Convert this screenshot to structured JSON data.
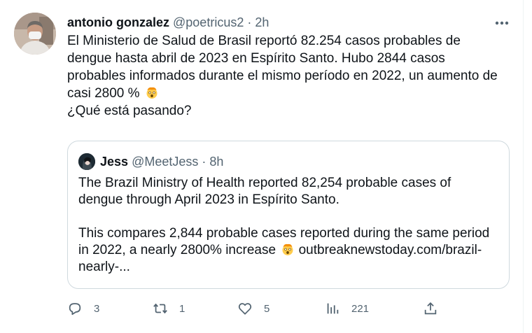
{
  "tweet": {
    "display_name": "antonio gonzalez",
    "handle": "@poetricus2",
    "separator": "·",
    "time": "2h",
    "avatar": "user-avatar-photo",
    "more_icon": "more-horizontal-icon",
    "text_lines": [
      "El Ministerio de Salud de Brasil reportó 82.254 casos probables de",
      "dengue hasta abril de 2023 en Espírito Santo. Hubo 2844 casos",
      "probables informados durante el mismo período en 2022, un aumento de",
      "casi 2800 %",
      "¿Qué está pasando?"
    ],
    "emoji": "exploding-head-emoji"
  },
  "quote": {
    "display_name": "Jess",
    "handle": "@MeetJess",
    "separator": "·",
    "time": "8h",
    "paragraph1": [
      "The Brazil Ministry of Health reported 82,254 probable cases of",
      "dengue through April 2023 in Espírito Santo."
    ],
    "paragraph2": [
      "This compares 2,844 probable cases reported during the same period",
      "in 2022, a nearly 2800% increase",
      "outbreaknewstoday.com/brazil-",
      "nearly-..."
    ]
  },
  "actions": {
    "replies": "3",
    "retweets": "1",
    "likes": "5",
    "views": "221",
    "icons": [
      "reply-icon",
      "retweet-icon",
      "like-icon",
      "views-icon",
      "share-icon"
    ]
  },
  "colors": {
    "text": "#0f1419",
    "secondary": "#536471",
    "border": "#cfd9de"
  }
}
